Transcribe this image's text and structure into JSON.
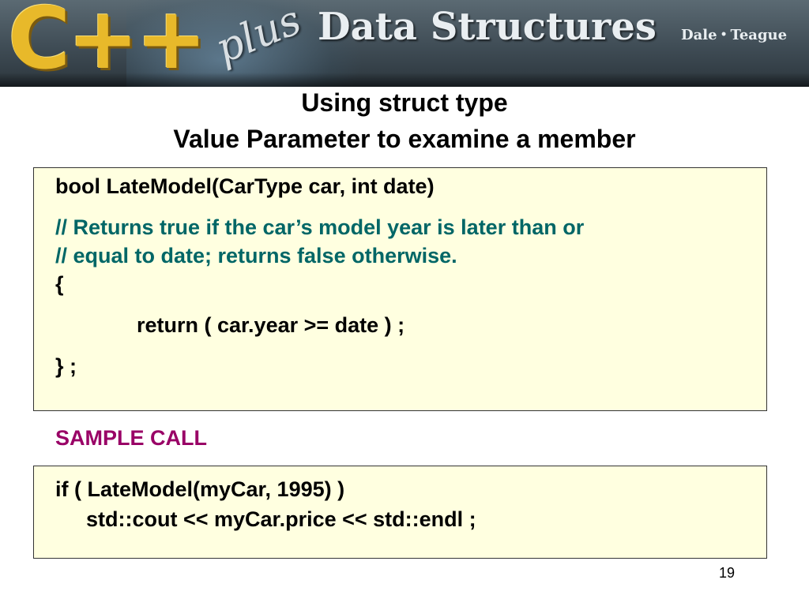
{
  "banner": {
    "logo_cpp": "C++",
    "logo_plus": "plus",
    "title": "Data Structures",
    "author1": "Dale",
    "author_separator": "•",
    "author2": "Teague"
  },
  "slide": {
    "title_line1": "Using struct type",
    "title_line2": "Value Parameter to examine a member"
  },
  "function_box": {
    "signature": "bool  LateModel(CarType  car,  int date)",
    "comment_line1": "//  Returns true if the car’s model year is later than or",
    "comment_line2": "//  equal to date;  returns false otherwise.",
    "open_brace": "{",
    "return_stmt": "return  ( car.year  >=  date ) ;",
    "close_brace": "} ;"
  },
  "sample_label": "SAMPLE CALL",
  "sample_box": {
    "line1": "if ( LateModel(myCar, 1995) )",
    "line2": "std::cout << myCar.price << std::endl ;"
  },
  "page_number": "19",
  "colors": {
    "box_background": "#ffffe0",
    "comment": "#006666",
    "sample_label": "#990066",
    "logo_gold": "#e8b92a"
  }
}
